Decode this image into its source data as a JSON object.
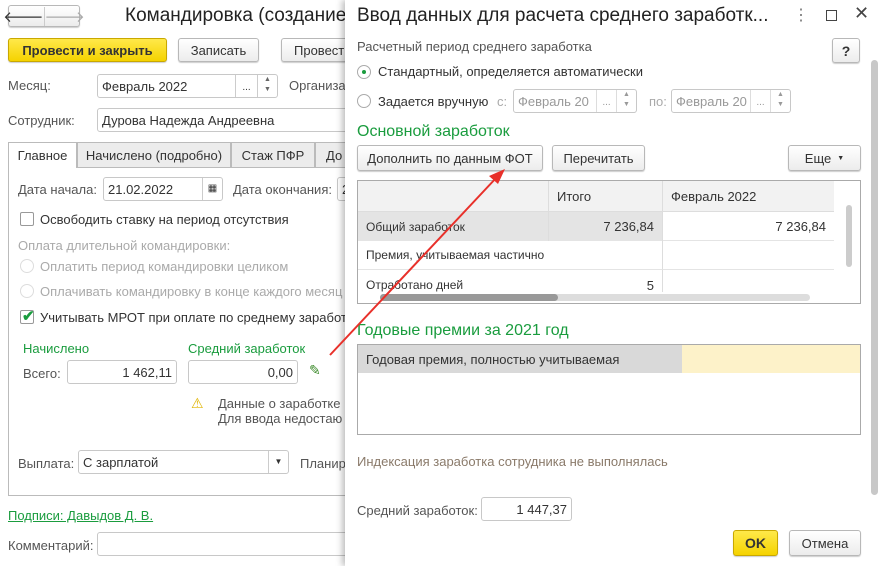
{
  "main": {
    "title": "Командировка (создание",
    "post_close": "Провести и закрыть",
    "save": "Записать",
    "post": "Провест",
    "month_label": "Месяц:",
    "month_value": "Февраль 2022",
    "org_label": "Организа",
    "employee_label": "Сотрудник:",
    "employee_value": "Дурова Надежда Андреевна",
    "tabs": [
      {
        "label": "Главное"
      },
      {
        "label": "Начислено (подробно)"
      },
      {
        "label": "Стаж ПФР"
      },
      {
        "label": "До"
      }
    ],
    "start_label": "Дата начала:",
    "start_value": "21.02.2022",
    "end_label": "Дата окончания:",
    "end_value": "2",
    "free_rate": "Освободить ставку на период отсутствия",
    "long_trip_label": "Оплата длительной командировки:",
    "pay_whole": "Оплатить период командировки целиком",
    "pay_monthly": "Оплачивать командировку в конце каждого месяц",
    "mrot": "Учитывать МРОТ при оплате по среднему заработ",
    "accrued_head": "Начислено",
    "avg_head": "Средний заработок",
    "total_label": "Всего:",
    "total_value": "1 462,11",
    "avg_value": "0,00",
    "warning_line1": "Данные о заработке н",
    "warning_line2": "Для ввода недостаю",
    "payout_label": "Выплата:",
    "payout_value": "С зарплатой",
    "planned_label": "Планир",
    "signatures_link": "Подписи: Давыдов Д. В.",
    "comment_label": "Комментарий:",
    "comment_value": ""
  },
  "dialog": {
    "title": "Ввод данных для расчета среднего заработк...",
    "help": "?",
    "period_label": "Расчетный период среднего заработка",
    "standard": "Стандартный, определяется автоматически",
    "manual": "Задается вручную",
    "from_label": "с:",
    "from_value": "Февраль 20",
    "to_label": "по:",
    "to_value": "Февраль 20",
    "main_section": "Основной заработок",
    "fill_fot": "Дополнить по данным ФОТ",
    "reread": "Перечитать",
    "more": "Еще",
    "table": {
      "headers": [
        "",
        "Итого",
        "Февраль 2022"
      ],
      "rows": [
        [
          "Общий заработок",
          "7 236,84",
          "7 236,84"
        ],
        [
          "Премия, учитываемая частично",
          "",
          ""
        ],
        [
          "Отработано дней",
          "5",
          ""
        ]
      ]
    },
    "annual_section": "Годовые премии за 2021 год",
    "annual_row": "Годовая премия, полностью учитываемая",
    "indexation": "Индексация заработка сотрудника не выполнялась",
    "avg_label": "Средний заработок:",
    "avg_value": "1 447,37",
    "ok": "OK",
    "cancel": "Отмена"
  },
  "colors": {
    "accent_yellow": "#f5d300",
    "section_green": "#1a9c3e",
    "annotation_arrow": "#e8302a"
  }
}
